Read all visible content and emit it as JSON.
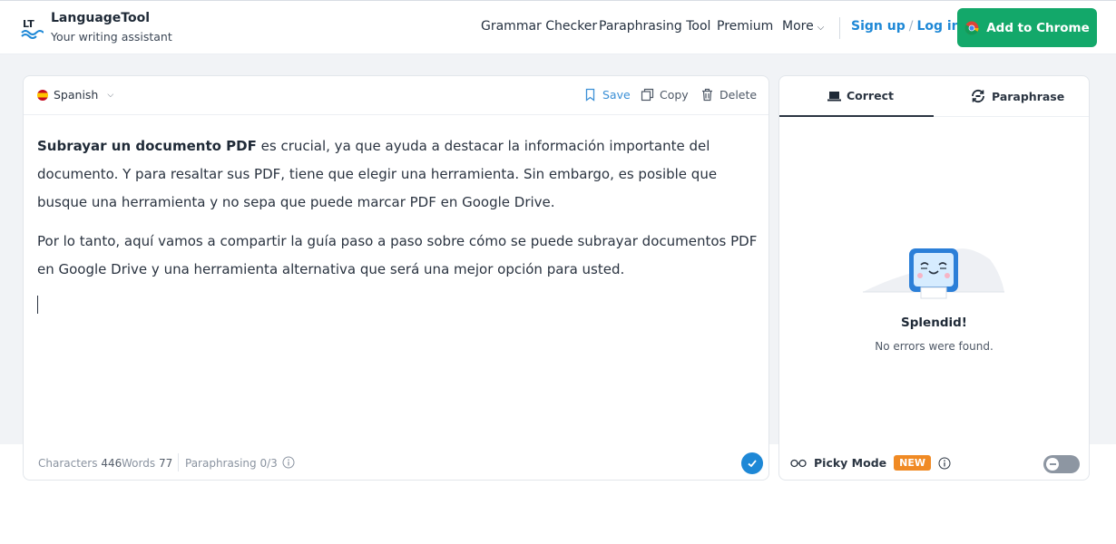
{
  "header": {
    "brand_name": "LanguageTool",
    "tagline": "Your writing assistant",
    "nav": {
      "grammar_checker": "Grammar Checker",
      "paraphrasing_tool": "Paraphrasing Tool",
      "premium": "Premium",
      "more": "More"
    },
    "sign_up": "Sign up",
    "slash": "/",
    "log_in": "Log in",
    "add_to_chrome": "Add to Chrome"
  },
  "editor": {
    "language": "Spanish",
    "actions": {
      "save": "Save",
      "copy": "Copy",
      "delete": "Delete"
    },
    "paragraph1_bold": "Subrayar un documento PDF",
    "paragraph1_rest": " es crucial, ya que ayuda a destacar la información importante del documento. Y para resaltar sus PDF, tiene que elegir una herramienta. Sin embargo, es posible que busque una herramienta y no sepa que puede marcar PDF en Google Drive.",
    "paragraph2": "Por lo tanto, aquí vamos a compartir la guía paso a paso sobre cómo se puede subrayar documentos PDF en Google Drive y una herramienta alternativa que será una mejor opción para usted.",
    "footer": {
      "characters_label": "Characters",
      "characters_value": "446",
      "words_label": "Words",
      "words_value": "77",
      "paraphrasing_label": "Paraphrasing 0/3"
    }
  },
  "sidebar": {
    "tab_correct": "Correct",
    "tab_paraphrase": "Paraphrase",
    "title": "Splendid!",
    "message": "No errors were found.",
    "picky_mode": "Picky Mode",
    "badge": "NEW"
  },
  "colors": {
    "accent_blue": "#1e88d6",
    "chrome_button": "#13a86a",
    "badge_orange": "#f08a24"
  },
  "icons": [
    "lt-logo-icon",
    "chevron-down-icon",
    "bookmark-icon",
    "copy-icon",
    "trash-icon",
    "info-icon",
    "check-icon",
    "laptop-icon",
    "paraphrase-icon",
    "mascot-icon",
    "glasses-icon",
    "chrome-icon"
  ]
}
